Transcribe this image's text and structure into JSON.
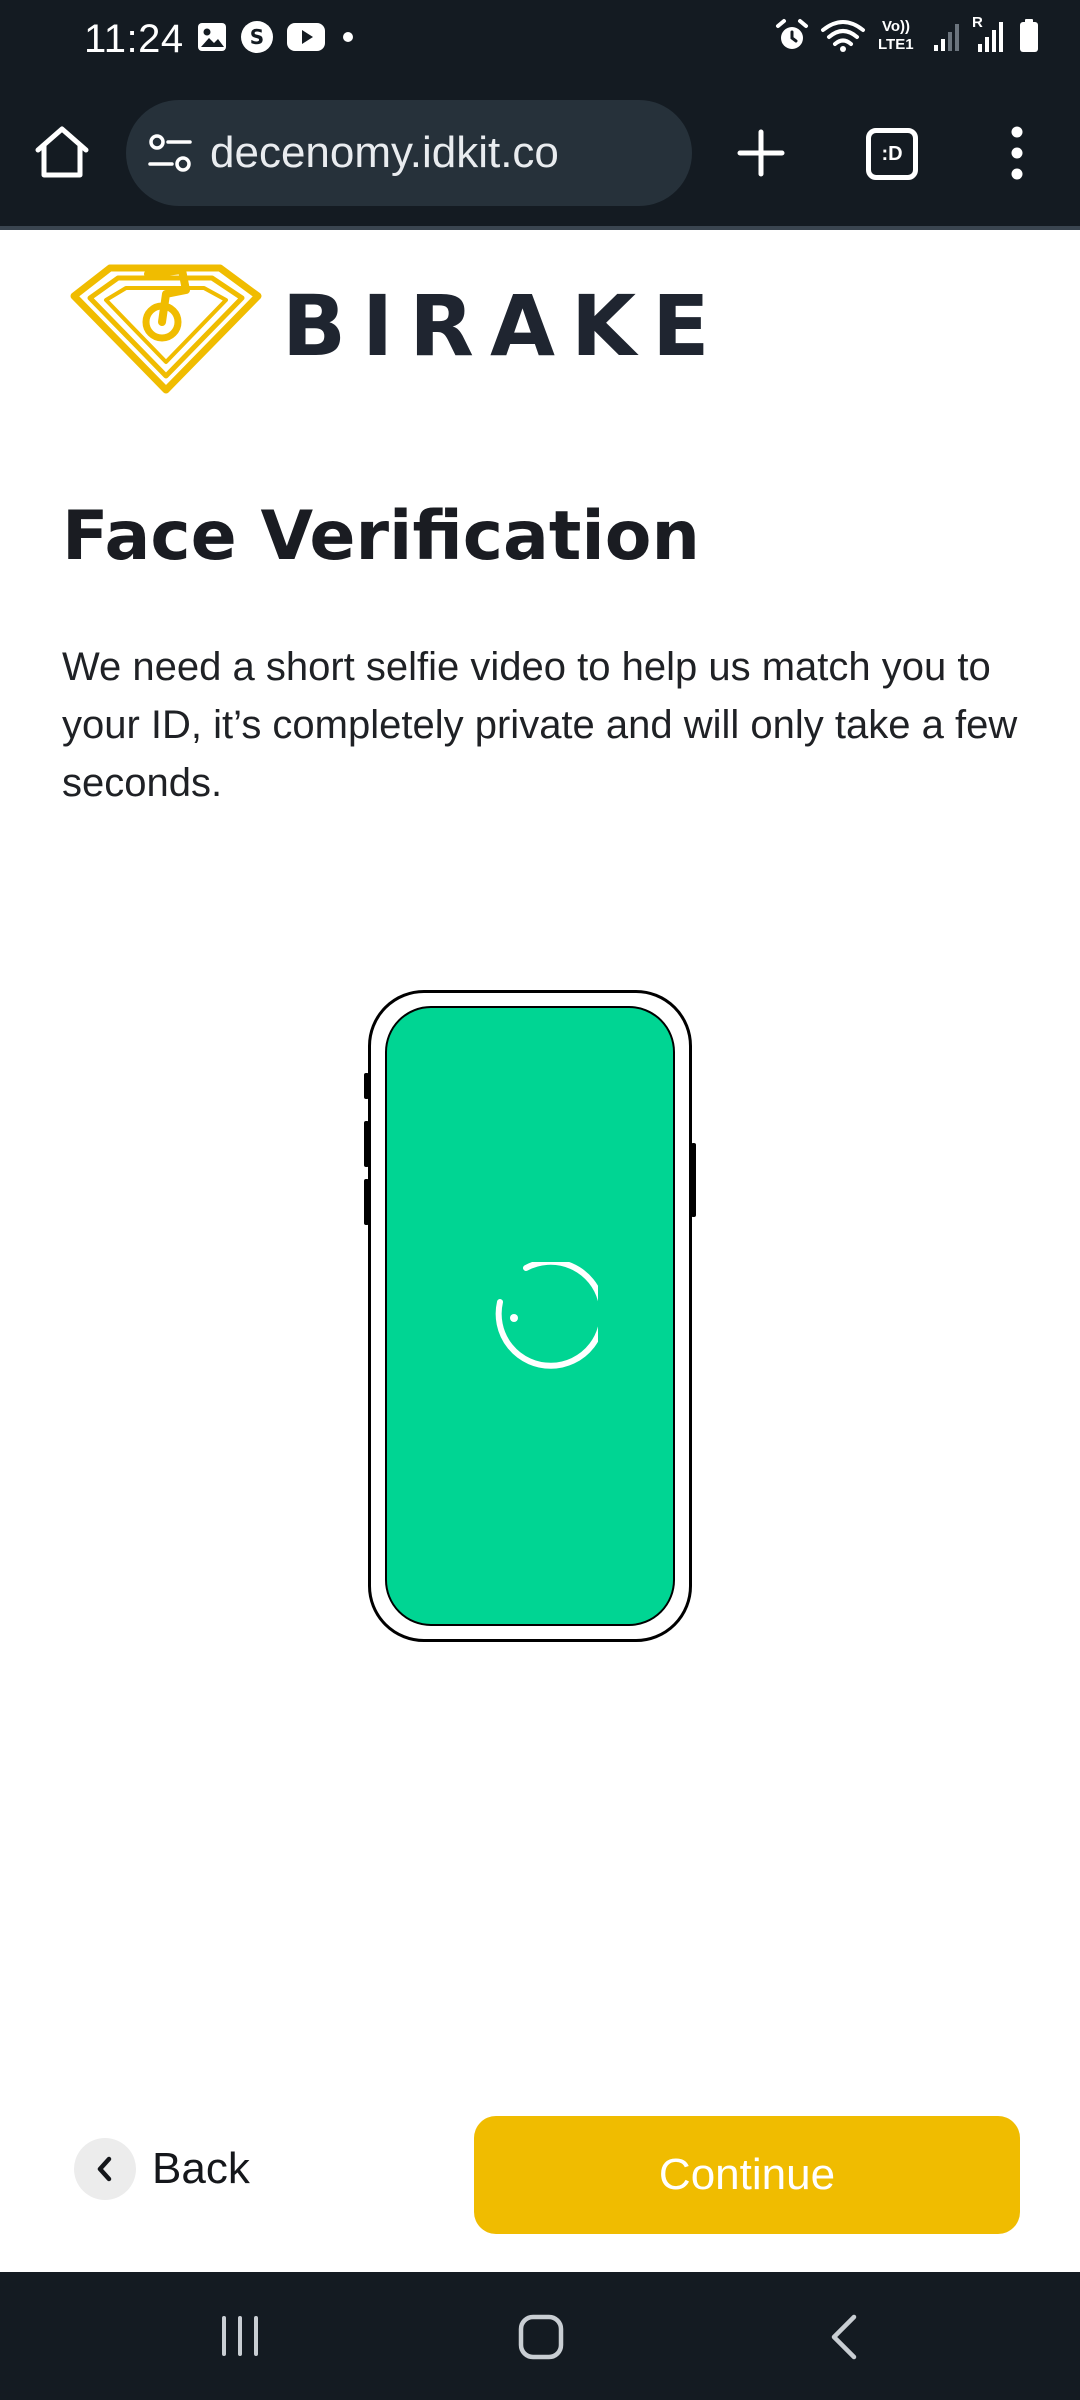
{
  "status_bar": {
    "time": "11:24",
    "left_icons": [
      "gallery-icon",
      "shazam-icon",
      "youtube-icon",
      "dot-icon"
    ],
    "right_icons": [
      "alarm-icon",
      "wifi-icon",
      "volte-icon",
      "signal-icon",
      "signal-icon",
      "battery-icon"
    ],
    "volte_label": "Vo))",
    "lte_label": "LTE1",
    "roaming_label": "R"
  },
  "browser": {
    "url": "decenomy.idkit.co",
    "tab_switcher_label": ":D"
  },
  "brand": {
    "name": "BIRAKE",
    "logo_color": "#f0bc00"
  },
  "page": {
    "title": "Face Verification",
    "description": "We need a short selfie video to help us match you to your ID, it’s completely private and will only take a few seconds."
  },
  "illustration": {
    "screen_color": "#00d593"
  },
  "actions": {
    "back_label": "Back",
    "continue_label": "Continue",
    "continue_color": "#f0bc00"
  }
}
